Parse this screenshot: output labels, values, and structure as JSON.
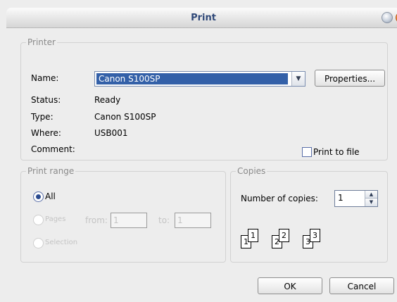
{
  "window": {
    "title": "Print"
  },
  "printer": {
    "group_label": "Printer",
    "name_label": "Name:",
    "name_value": "Canon S100SP",
    "properties_label": "Properties...",
    "status_label": "Status:",
    "status_value": "Ready",
    "type_label": "Type:",
    "type_value": "Canon S100SP",
    "where_label": "Where:",
    "where_value": "USB001",
    "comment_label": "Comment:",
    "comment_value": "",
    "print_to_file_label": "Print to file",
    "print_to_file_checked": false
  },
  "print_range": {
    "group_label": "Print range",
    "all_label": "All",
    "pages_label": "Pages",
    "from_label": "from:",
    "from_value": "1",
    "to_label": "to:",
    "to_value": "1",
    "selection_label": "Selection",
    "selected": "All"
  },
  "copies": {
    "group_label": "Copies",
    "number_label": "Number of copies:",
    "number_value": "1",
    "collate_pages": [
      "1",
      "1",
      "2",
      "2",
      "3",
      "3"
    ]
  },
  "buttons": {
    "ok_label": "OK",
    "cancel_label": "Cancel"
  },
  "colors": {
    "accent": "#3360a8",
    "title_text": "#2f4878",
    "close": "#f17f2a"
  }
}
